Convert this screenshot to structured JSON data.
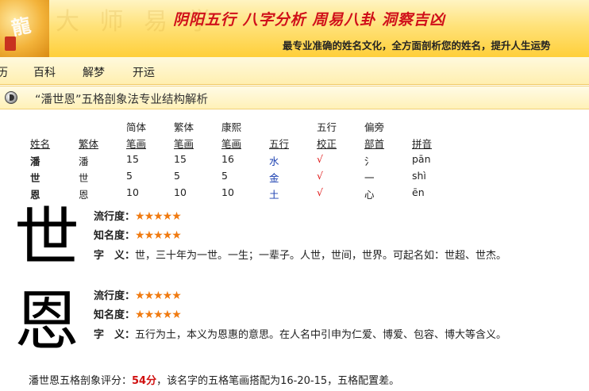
{
  "header": {
    "logo_alt": "logo",
    "watermark": "大 师 易 学",
    "slogan": "阴阳五行  八字分析  周易八卦  洞察吉凶",
    "tagline": "最专业准确的姓名文化，全方面剖析您的姓名，提升人生运势"
  },
  "nav": {
    "items": [
      "历",
      "百科",
      "解梦",
      "开运"
    ]
  },
  "section": {
    "title": "“潘世恩”五格剖象法专业结构解析"
  },
  "table": {
    "headers_top": [
      "简体",
      "繁体",
      "康熙",
      "五行",
      "偏旁"
    ],
    "headers": [
      "姓名",
      "繁体",
      "笔画",
      "笔画",
      "笔画",
      "五行",
      "校正",
      "部首",
      "拼音"
    ],
    "rows": [
      {
        "name": "潘",
        "trad": "潘",
        "simp": "15",
        "trad_s": "15",
        "kx": "16",
        "wx": "水",
        "check": "√",
        "radical": "氵",
        "pinyin": "pān"
      },
      {
        "name": "世",
        "trad": "世",
        "simp": "5",
        "trad_s": "5",
        "kx": "5",
        "wx": "金",
        "check": "√",
        "radical": "一",
        "pinyin": "shì"
      },
      {
        "name": "恩",
        "trad": "恩",
        "simp": "10",
        "trad_s": "10",
        "kx": "10",
        "wx": "土",
        "check": "√",
        "radical": "心",
        "pinyin": "ēn"
      }
    ]
  },
  "chars": [
    {
      "char": "世",
      "popularity_label": "流行度：",
      "popularity_stars": "★★★★★",
      "fame_label": "知名度：",
      "fame_stars": "★★★★★",
      "meaning_label": "字　义：",
      "meaning": "世，三十年为一世。一生；一辈子。人世，世间，世界。可起名如：世超、世杰。"
    },
    {
      "char": "恩",
      "popularity_label": "流行度：",
      "popularity_stars": "★★★★★",
      "fame_label": "知名度：",
      "fame_stars": "★★★★★",
      "meaning_label": "字　义：",
      "meaning": "五行为土，本义为恩惠的意思。在人名中引申为仁爱、博爱、包容、博大等含义。"
    }
  ],
  "score": {
    "prefix": "潘世恩五格剖象评分：",
    "value": "54分",
    "suffix": "，该名字的五格笔画搭配为16-20-15，五格配置差。"
  }
}
